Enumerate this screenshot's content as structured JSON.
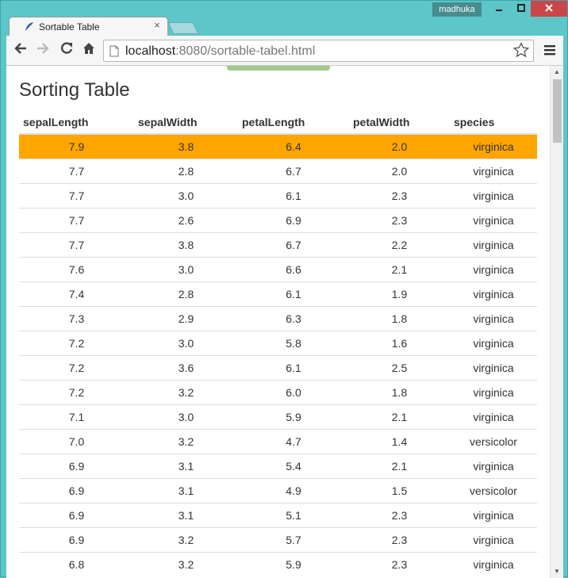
{
  "browser": {
    "tab_title": "Sortable Table",
    "tab_close": "×",
    "user_name": "madhuka",
    "url_host": "localhost",
    "url_rest": ":8080/sortable-tabel.html",
    "icons": {
      "back": "back-arrow-icon",
      "forward": "forward-arrow-icon",
      "reload": "reload-icon",
      "home": "home-icon",
      "page": "page-icon",
      "star": "bookmark-star-icon",
      "menu": "hamburger-menu-icon",
      "favicon": "feather-icon"
    }
  },
  "page": {
    "title": "Sorting Table",
    "columns": [
      "sepalLength",
      "sepalWidth",
      "petalLength",
      "petalWidth",
      "species"
    ],
    "selected_row_color": "#ffa500",
    "rows": [
      [
        "7.9",
        "3.8",
        "6.4",
        "2.0",
        "virginica"
      ],
      [
        "7.7",
        "2.8",
        "6.7",
        "2.0",
        "virginica"
      ],
      [
        "7.7",
        "3.0",
        "6.1",
        "2.3",
        "virginica"
      ],
      [
        "7.7",
        "2.6",
        "6.9",
        "2.3",
        "virginica"
      ],
      [
        "7.7",
        "3.8",
        "6.7",
        "2.2",
        "virginica"
      ],
      [
        "7.6",
        "3.0",
        "6.6",
        "2.1",
        "virginica"
      ],
      [
        "7.4",
        "2.8",
        "6.1",
        "1.9",
        "virginica"
      ],
      [
        "7.3",
        "2.9",
        "6.3",
        "1.8",
        "virginica"
      ],
      [
        "7.2",
        "3.0",
        "5.8",
        "1.6",
        "virginica"
      ],
      [
        "7.2",
        "3.6",
        "6.1",
        "2.5",
        "virginica"
      ],
      [
        "7.2",
        "3.2",
        "6.0",
        "1.8",
        "virginica"
      ],
      [
        "7.1",
        "3.0",
        "5.9",
        "2.1",
        "virginica"
      ],
      [
        "7.0",
        "3.2",
        "4.7",
        "1.4",
        "versicolor"
      ],
      [
        "6.9",
        "3.1",
        "5.4",
        "2.1",
        "virginica"
      ],
      [
        "6.9",
        "3.1",
        "4.9",
        "1.5",
        "versicolor"
      ],
      [
        "6.9",
        "3.1",
        "5.1",
        "2.3",
        "virginica"
      ],
      [
        "6.9",
        "3.2",
        "5.7",
        "2.3",
        "virginica"
      ],
      [
        "6.8",
        "3.2",
        "5.9",
        "2.3",
        "virginica"
      ]
    ]
  }
}
